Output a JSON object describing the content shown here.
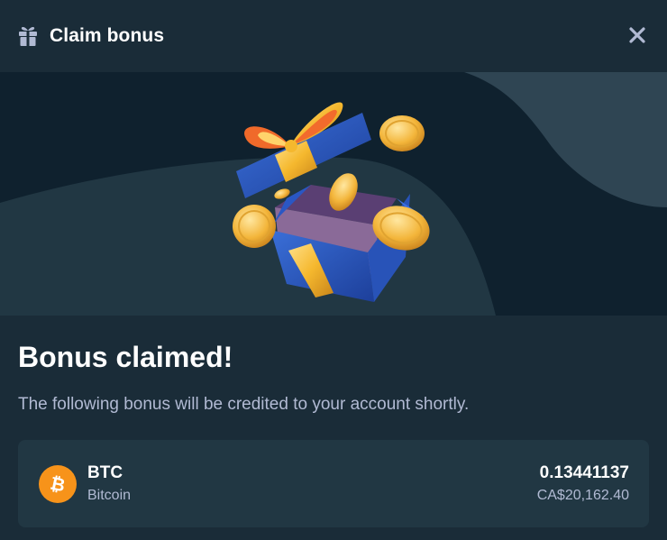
{
  "header": {
    "title": "Claim bonus",
    "gift_icon": "gift-icon",
    "close_icon": "close-icon"
  },
  "hero": {
    "illustration": "open-gift-box-with-coins"
  },
  "main": {
    "heading": "Bonus claimed!",
    "subtitle": "The following bonus will be credited to your account shortly."
  },
  "bonus": {
    "currency_symbol": "BTC",
    "currency_name": "Bitcoin",
    "currency_icon": "bitcoin-icon",
    "amount": "0.13441137",
    "fiat_value": "CA$20,162.40"
  },
  "colors": {
    "background": "#1a2c38",
    "hero_dark": "#0f212e",
    "hero_wave": "#213743",
    "card": "#213743",
    "muted_text": "#b1bad3",
    "bitcoin_orange": "#f7931a"
  }
}
